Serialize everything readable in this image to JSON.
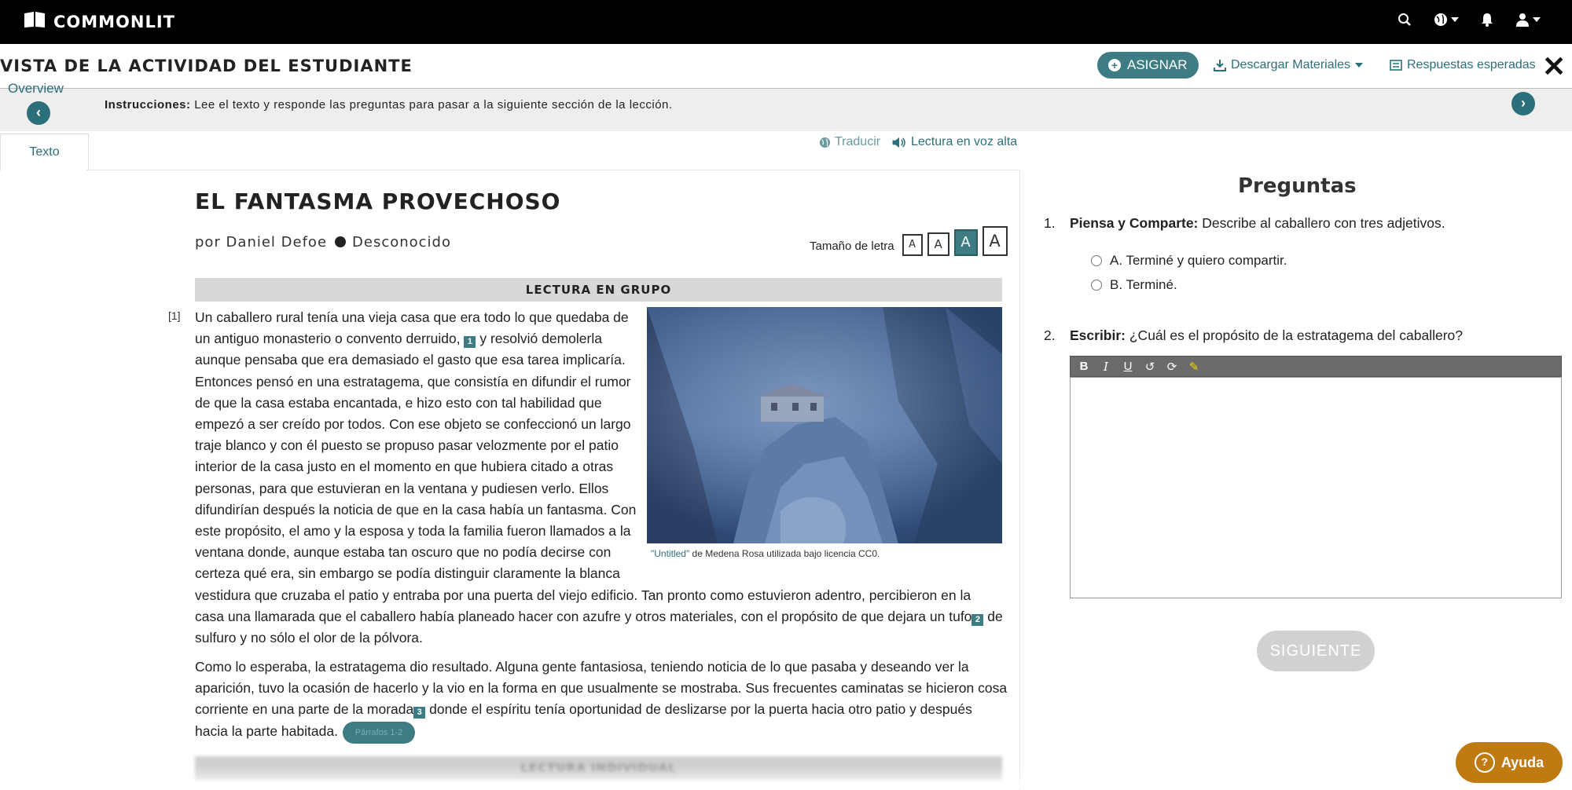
{
  "topbar": {
    "logo_text": "COMMONLIT",
    "icons": [
      "search-icon",
      "globe-icon",
      "bell-icon",
      "user-icon"
    ]
  },
  "header": {
    "title": "VISTA DE LA ACTIVIDAD DEL ESTUDIANTE",
    "assign_label": "ASIGNAR",
    "download_label": "Descargar Materiales",
    "answers_label": "Respuestas esperadas"
  },
  "instructions": {
    "overview_label": "Overview",
    "label": "Instrucciones:",
    "text": " Lee el texto y responde las preguntas para pasar a la siguiente sección de la lección."
  },
  "tabs": {
    "text_tab": "Texto"
  },
  "tools": {
    "translate": "Traducir",
    "read_aloud": "Lectura en voz alta"
  },
  "article": {
    "title": "EL FANTASMA PROVECHOSO",
    "author": "por Daniel Defoe",
    "origin": "Desconocido",
    "font_size_label": "Tamaño de letra",
    "font_button": "A",
    "section_group": "LECTURA EN GRUPO",
    "section_individual": "LECTURA INDIVIDUAL",
    "paragraph_number": "[1]",
    "p1_lines": [
      "Un caballero rural tenía una vieja casa que era todo lo que quedaba de",
      "un antiguo monasterio o convento derruido,",
      "y resolvió demolerla",
      "aunque pensaba que era demasiado el gasto que esa tarea implicaría.",
      "Entonces pensó en una estratagema, que consistía en difundir el rumor",
      "de que la casa estaba encantada, e hizo esto con tal habilidad que",
      "empezó a ser creído por todos. Con ese objeto se confeccionó un largo",
      "traje blanco y con él puesto se propuso pasar velozmente por el patio",
      "interior de la casa justo en el momento en que hubiera citado a otras",
      "personas, para que estuvieran en la ventana y pudiesen verlo. Ellos",
      "difundirían después la noticia de que en la casa había un fantasma. Con",
      "este propósito, el amo y la esposa y toda la familia fueron llamados a la",
      "ventana donde, aunque estaba tan oscuro que no podía decirse con",
      "certeza qué era, sin embargo se podía distinguir claramente la blanca",
      "vestidura que cruzaba el patio y entraba por una puerta del viejo edificio. Tan pronto como estuvieron adentro, percibieron en la",
      "casa una llamarada que el caballero había planeado hacer con azufre y otros materiales, con el propósito de que dejara un tufo",
      "de",
      "sulfuro y no sólo el olor de la pólvora."
    ],
    "p2_lines": [
      "Como lo esperaba, la estratagema dio resultado. Alguna gente fantasiosa, teniendo noticia de lo que pasaba y deseando ver la",
      "aparición, tuvo la ocasión de hacerlo y la vio en la forma en que usualmente se mostraba. Sus frecuentes caminatas se hicieron cosa",
      "corriente en una parte de la morada",
      "donde el espíritu tenía oportunidad de deslizarse por la puerta hacia otro patio y después",
      "hacia la parte habitada."
    ],
    "footnotes": [
      "1",
      "2",
      "3"
    ],
    "caption_link": "\"Untitled\"",
    "caption_text": " de Medena Rosa utilizada bajo licencia CC0.",
    "paragraph_pill": "Párrafos 1-2"
  },
  "questions": {
    "title": "Preguntas",
    "q1_number": "1.",
    "q1_label": "Piensa y Comparte:",
    "q1_text": " Describe al caballero con tres adjetivos.",
    "q1_options": [
      "A.  Terminé y quiero compartir.",
      "B.  Terminé."
    ],
    "q2_number": "2.",
    "q2_label": "Escribir:",
    "q2_text": " ¿Cuál es el propósito de la estratagema del caballero?",
    "next_label": "SIGUIENTE"
  },
  "help": {
    "label": "Ayuda"
  },
  "colors": {
    "accent": "#3c7c82",
    "link": "#2b6f7a",
    "help": "#c07a12"
  }
}
